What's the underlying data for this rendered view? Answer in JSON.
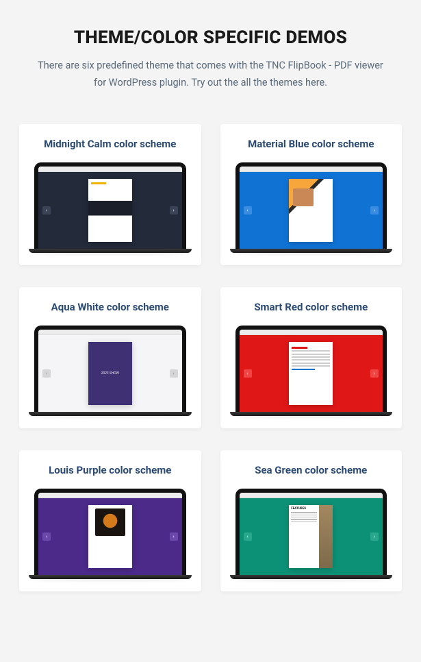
{
  "header": {
    "title": "THEME/COLOR SPECIFIC DEMOS",
    "subtitle": "There are six predefined theme that comes with the TNC FlipBook - PDF viewer for WordPress plugin. Try out the all the themes here."
  },
  "cards": [
    {
      "title": "Midnight Calm color scheme",
      "theme": "midnight"
    },
    {
      "title": "Material Blue color scheme",
      "theme": "material"
    },
    {
      "title": "Aqua White color scheme",
      "theme": "aqua"
    },
    {
      "title": "Smart Red color scheme",
      "theme": "smart"
    },
    {
      "title": "Louis Purple color scheme",
      "theme": "louis"
    },
    {
      "title": "Sea Green color scheme",
      "theme": "seagreen"
    }
  ],
  "nav": {
    "prev_icon": "‹",
    "next_icon": "›"
  },
  "aqua_doc_text": "2023\nSHOW",
  "sea_features_label": "FEATURES"
}
